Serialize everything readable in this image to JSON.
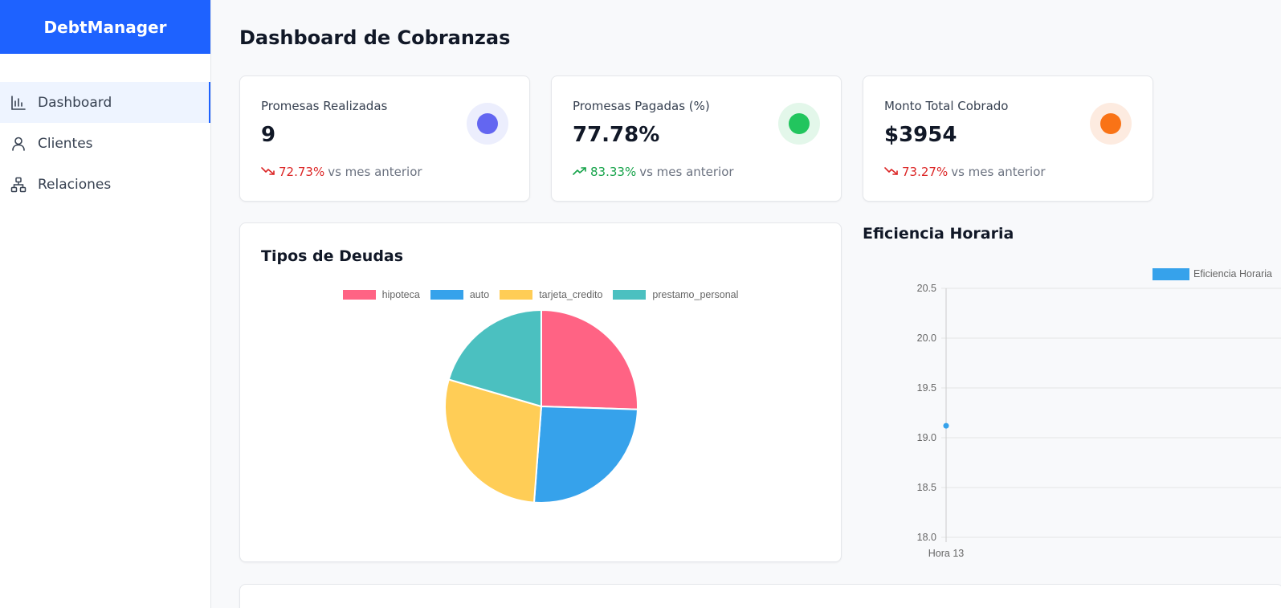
{
  "app": {
    "brand": "DebtManager"
  },
  "sidebar": {
    "items": [
      {
        "label": "Dashboard",
        "icon": "bar-chart-icon",
        "active": true
      },
      {
        "label": "Clientes",
        "icon": "user-icon",
        "active": false
      },
      {
        "label": "Relaciones",
        "icon": "network-icon",
        "active": false
      }
    ]
  },
  "page": {
    "title": "Dashboard de Cobranzas"
  },
  "kpis": [
    {
      "label": "Promesas Realizadas",
      "value": "9",
      "change": "72.73%",
      "change_suffix": "vs mes anterior",
      "direction": "down",
      "accent": "#6366f1",
      "accent_bg": "#eceefd"
    },
    {
      "label": "Promesas Pagadas (%)",
      "value": "77.78%",
      "change": "83.33%",
      "change_suffix": "vs mes anterior",
      "direction": "up",
      "accent": "#22c55e",
      "accent_bg": "#e3f7ea"
    },
    {
      "label": "Monto Total Cobrado",
      "value": "$3954",
      "change": "73.27%",
      "change_suffix": "vs mes anterior",
      "direction": "down",
      "accent": "#f97316",
      "accent_bg": "#fdebe0"
    }
  ],
  "colors": {
    "primary": "#1e62ff",
    "down": "#dc2626",
    "up": "#16a34a"
  },
  "chart_data": [
    {
      "type": "pie",
      "title": "Tipos de Deudas",
      "categories": [
        "hipoteca",
        "auto",
        "tarjeta_credito",
        "prestamo_personal"
      ],
      "values": [
        25.5,
        25.7,
        28.3,
        20.5
      ],
      "colors": [
        "#ff6384",
        "#36a2eb",
        "#ffcd56",
        "#4bc0c0"
      ],
      "legend": "top"
    },
    {
      "type": "line",
      "title": "Eficiencia Horaria",
      "categories": [
        "Hora 13"
      ],
      "series": [
        {
          "name": "Eficiencia Horaria",
          "values": [
            19.12
          ],
          "color": "#36a2eb"
        }
      ],
      "ylim": [
        18.0,
        20.5
      ],
      "yticks": [
        "20.5",
        "20.0",
        "19.5",
        "19.0",
        "18.5",
        "18.0"
      ],
      "grid": true,
      "legend": "top-right"
    }
  ]
}
